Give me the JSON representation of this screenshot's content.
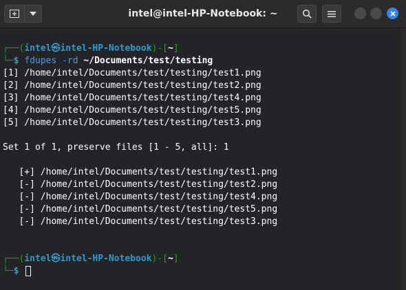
{
  "window": {
    "title": "intel@intel-HP-Notebook: ~"
  },
  "colors": {
    "accent": "#3584e4",
    "prompt_blue": "#3399cc",
    "prompt_green": "#1aa31a",
    "command": "#4d9de0"
  },
  "prompt1": {
    "user": "intel",
    "symbol": "㉿",
    "host": "intel-HP-Notebook",
    "sep": ")-[",
    "dir": "~",
    "close": "]",
    "command": "fdupes -rd",
    "argument": "~/Documents/test/testing"
  },
  "output": {
    "files": [
      "[1] /home/intel/Documents/test/testing/test1.png",
      "[2] /home/intel/Documents/test/testing/test2.png",
      "[3] /home/intel/Documents/test/testing/test4.png",
      "[4] /home/intel/Documents/test/testing/test5.png",
      "[5] /home/intel/Documents/test/testing/test3.png"
    ],
    "set_prompt": "Set 1 of 1, preserve files [1 - 5, all]: 1",
    "results": [
      "   [+] /home/intel/Documents/test/testing/test1.png",
      "   [-] /home/intel/Documents/test/testing/test2.png",
      "   [-] /home/intel/Documents/test/testing/test4.png",
      "   [-] /home/intel/Documents/test/testing/test5.png",
      "   [-] /home/intel/Documents/test/testing/test3.png"
    ]
  },
  "prompt2": {
    "user": "intel",
    "symbol": "㉿",
    "host": "intel-HP-Notebook",
    "sep": ")-[",
    "dir": "~",
    "close": "]"
  },
  "icons": [
    "new-tab-icon",
    "chevron-down-icon",
    "search-icon",
    "hamburger-menu-icon",
    "close-icon"
  ]
}
